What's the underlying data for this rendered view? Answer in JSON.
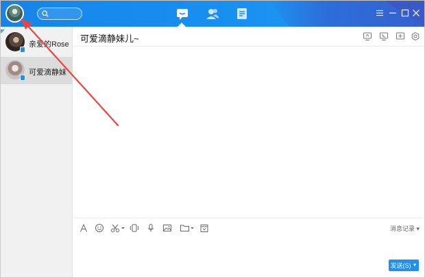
{
  "search": {
    "placeholder": ""
  },
  "nav": {
    "tabs": [
      {
        "icon": "chat-bubble-icon",
        "active": true
      },
      {
        "icon": "contacts-icon",
        "active": false
      },
      {
        "icon": "notes-icon",
        "active": false
      }
    ]
  },
  "window_controls": [
    "menu-icon",
    "minimize-icon",
    "maximize-icon",
    "close-icon"
  ],
  "contacts": [
    {
      "name": "亲爱的Rose",
      "selected": false
    },
    {
      "name": "可爱滴静妹",
      "selected": true
    }
  ],
  "chat": {
    "title": "可爱滴静妹儿~",
    "header_icons": [
      "screen-share-icon",
      "phone-icon",
      "add-member-icon",
      "settings-icon"
    ]
  },
  "toolbar": {
    "history_label": "消息记录",
    "tools": [
      "font-icon",
      "emoji-icon",
      "scissors-icon",
      "shake-icon",
      "mic-icon",
      "image-icon",
      "folder-icon",
      "calendar-icon"
    ]
  },
  "composer": {
    "send_label": "发送(S)"
  },
  "colors": {
    "accent": "#1f8ff0",
    "titlebar": "#1890f0",
    "annotation": "#e8453c"
  }
}
